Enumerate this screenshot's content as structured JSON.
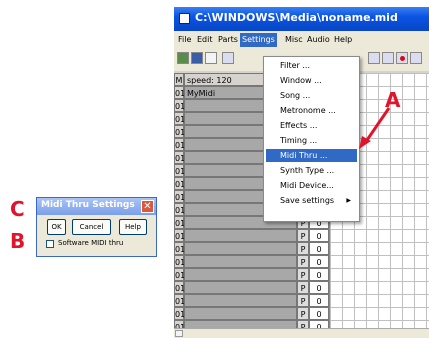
{
  "window": {
    "title": "C:\\WINDOWS\\Media\\noname.mid"
  },
  "menubar": {
    "items": [
      "File",
      "Edit",
      "Parts",
      "Settings",
      "Misc",
      "Audio",
      "Help"
    ],
    "active": "Settings"
  },
  "track_list": {
    "header_m": "M",
    "header_speed": "speed: 120",
    "rows": [
      {
        "num": "01",
        "name": "MyMidi",
        "p": "",
        "v": ""
      },
      {
        "num": "01",
        "name": "",
        "p": "",
        "v": ""
      },
      {
        "num": "01",
        "name": "",
        "p": "",
        "v": ""
      },
      {
        "num": "01",
        "name": "",
        "p": "",
        "v": ""
      },
      {
        "num": "01",
        "name": "",
        "p": "",
        "v": ""
      },
      {
        "num": "01",
        "name": "",
        "p": "",
        "v": ""
      },
      {
        "num": "01",
        "name": "",
        "p": "",
        "v": ""
      },
      {
        "num": "01",
        "name": "",
        "p": "",
        "v": ""
      },
      {
        "num": "01",
        "name": "",
        "p": "P",
        "v": "0"
      },
      {
        "num": "01",
        "name": "",
        "p": "P",
        "v": "0"
      },
      {
        "num": "01",
        "name": "",
        "p": "P",
        "v": "0"
      },
      {
        "num": "01",
        "name": "",
        "p": "P",
        "v": "0"
      },
      {
        "num": "01",
        "name": "",
        "p": "P",
        "v": "0"
      },
      {
        "num": "01",
        "name": "",
        "p": "P",
        "v": "0"
      },
      {
        "num": "01",
        "name": "",
        "p": "P",
        "v": "0"
      },
      {
        "num": "01",
        "name": "",
        "p": "P",
        "v": "0"
      },
      {
        "num": "01",
        "name": "",
        "p": "P",
        "v": "0"
      },
      {
        "num": "01",
        "name": "",
        "p": "P",
        "v": "0"
      },
      {
        "num": "01",
        "name": "",
        "p": "P",
        "v": "0"
      }
    ]
  },
  "settings_menu": {
    "items": [
      {
        "label": "Filter ...",
        "submenu": false
      },
      {
        "label": "Window ...",
        "submenu": false
      },
      {
        "label": "Song ...",
        "submenu": false
      },
      {
        "label": "Metronome ...",
        "submenu": false
      },
      {
        "label": "Effects ...",
        "submenu": false
      },
      {
        "label": "Timing ...",
        "submenu": false
      },
      {
        "label": "Midi Thru ...",
        "submenu": false
      },
      {
        "label": "Synth Type ...",
        "submenu": false
      },
      {
        "label": "Midi Device...",
        "submenu": false
      },
      {
        "label": "Save settings",
        "submenu": true
      }
    ],
    "highlighted": "Midi Thru ..."
  },
  "dialog": {
    "title": "Midi Thru Settings",
    "close_glyph": "✕",
    "ok_label": "OK",
    "cancel_label": "Cancel",
    "help_label": "Help",
    "checkbox_label": "Software MIDI thru",
    "checkbox_checked": false
  },
  "annotations": {
    "a": "A",
    "b": "B",
    "c": "C"
  },
  "colors": {
    "annotation": "#e0142c",
    "highlight": "#316ac5",
    "titlebar": "#0a54e3"
  }
}
